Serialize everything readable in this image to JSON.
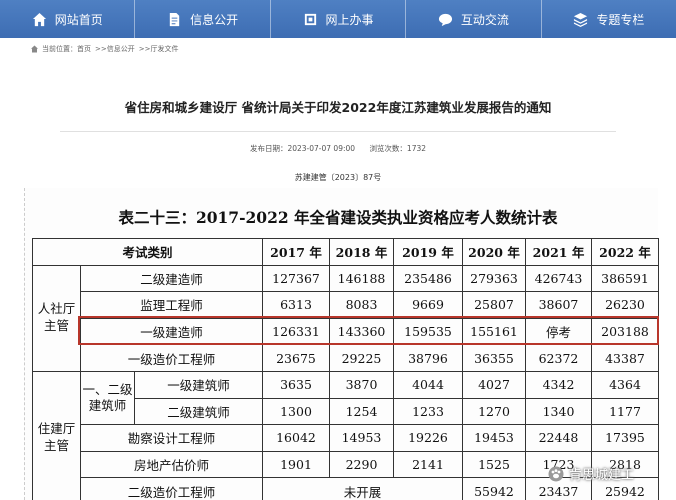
{
  "nav": {
    "items": [
      {
        "label": "网站首页",
        "icon": "home-icon"
      },
      {
        "label": "信息公开",
        "icon": "document-icon"
      },
      {
        "label": "网上办事",
        "icon": "service-icon"
      },
      {
        "label": "互动交流",
        "icon": "chat-icon"
      },
      {
        "label": "专题专栏",
        "icon": "topic-icon"
      }
    ]
  },
  "breadcrumb": {
    "items": [
      "当前位置：首页",
      ">>信息公开",
      ">>厅发文件"
    ]
  },
  "article": {
    "title": "省住房和城乡建设厅 省统计局关于印发2022年度江苏建筑业发展报告的通知",
    "publish_date": "发布日期：2023-07-07 09:00",
    "views": "浏览次数：1732",
    "doc_no": "苏建建管〔2023〕87号"
  },
  "table": {
    "title": "表二十三：2017-2022 年全省建设类执业资格应考人数统计表",
    "header": {
      "category": "考试类别",
      "years": [
        "2017 年",
        "2018 年",
        "2019 年",
        "2020 年",
        "2021 年",
        "2022 年"
      ]
    },
    "group1": {
      "label_line1": "人社厅",
      "label_line2": "主管",
      "rows": [
        {
          "name": "二级建造师",
          "values": [
            "127367",
            "146188",
            "235486",
            "279363",
            "426743",
            "386591"
          ]
        },
        {
          "name": "监理工程师",
          "values": [
            "6313",
            "8083",
            "9669",
            "25807",
            "38607",
            "26230"
          ]
        },
        {
          "name": "一级建造师",
          "values": [
            "126331",
            "143360",
            "159535",
            "155161",
            "停考",
            "203188"
          ]
        },
        {
          "name": "一级造价工程师",
          "values": [
            "23675",
            "29225",
            "38796",
            "36355",
            "62372",
            "43387"
          ]
        }
      ]
    },
    "group2": {
      "label_line1": "住建厅",
      "label_line2": "主管",
      "sub_label_line1": "一、二级",
      "sub_label_line2": "建筑师",
      "sub_rows": [
        {
          "name": "一级建筑师",
          "values": [
            "3635",
            "3870",
            "4044",
            "4027",
            "4342",
            "4364"
          ]
        },
        {
          "name": "二级建筑师",
          "values": [
            "1300",
            "1254",
            "1233",
            "1270",
            "1340",
            "1177"
          ]
        }
      ],
      "rows": [
        {
          "name": "勘察设计工程师",
          "values": [
            "16042",
            "14953",
            "19226",
            "19453",
            "22448",
            "17395"
          ]
        },
        {
          "name": "房地产估价师",
          "values": [
            "1901",
            "2290",
            "2141",
            "1525",
            "1723",
            "2818"
          ]
        }
      ],
      "last_row": {
        "name": "二级造价工程师",
        "merged": "未开展",
        "values": [
          "55942",
          "23437",
          "25942"
        ]
      }
    }
  },
  "watermark": {
    "text": "肯思城建工"
  },
  "colors": {
    "nav_bg": "#4577bb",
    "highlight": "#b8362b"
  }
}
